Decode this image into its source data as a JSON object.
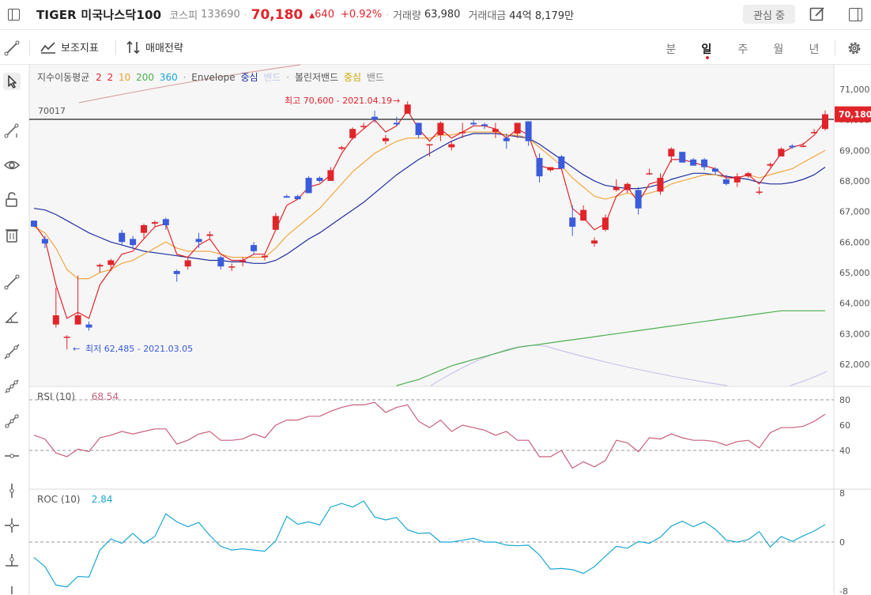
{
  "header": {
    "title": "TIGER 미국나스닥100",
    "market": "코스피",
    "code": "133690",
    "price": "70,180",
    "change": "640",
    "change_pct": "+0.92%",
    "volume_label": "거래량",
    "volume": "63,980",
    "amount_label": "거래대금",
    "amount": "44억 8,179만",
    "watch_label": "관심 중"
  },
  "toolbar": {
    "indicator_label": "보조지표",
    "strategy_label": "매매전략",
    "timeframes": [
      "분",
      "일",
      "주",
      "월",
      "년"
    ],
    "active_timeframe": "일"
  },
  "colors": {
    "up": "#e0242a",
    "down": "#3b5bdb",
    "ma2": "#e0242a",
    "ma10": "#f0a030",
    "ma200": "#4caf50",
    "ma360": "#7b88d4",
    "envelope": "#1e2f9e",
    "bollinger": "#c9b84a",
    "rsi": "#c8607a",
    "roc": "#1aa7d1"
  },
  "legend": {
    "ma_label": "지수이동평균",
    "ma_periods": [
      "2",
      "2",
      "10",
      "200",
      "360"
    ],
    "envelope_label": "Envelope",
    "envelope_center": "중심",
    "envelope_band": "밴드",
    "bollinger_label": "볼린저밴드",
    "bollinger_center": "중심",
    "bollinger_band": "밴드"
  },
  "chart_data": [
    {
      "type": "candlestick",
      "ylim": [
        61300,
        71800
      ],
      "y_ticks": [
        62000,
        63000,
        64000,
        65000,
        66000,
        67000,
        68000,
        69000,
        70000,
        71000
      ],
      "y_tick_labels": [
        "62,000",
        "63,000",
        "64,000",
        "65,000",
        "66,000",
        "67,000",
        "68,000",
        "69,000",
        "70,000",
        "71,000"
      ],
      "hline": 70017,
      "hline_label": "70017",
      "current_price_label": "70,180",
      "annotations": {
        "high": "최고 70,600 - 2021.04.19",
        "low": "최저 62,485 - 2021.03.05"
      },
      "ohlc": [
        [
          66700,
          66700,
          66500,
          66500
        ],
        [
          66100,
          66200,
          65800,
          65950
        ],
        [
          63300,
          64500,
          63200,
          63600
        ],
        [
          62900,
          62950,
          62485,
          62900
        ],
        [
          63300,
          64900,
          63300,
          63600
        ],
        [
          63300,
          63400,
          63100,
          63200
        ],
        [
          65200,
          65300,
          65000,
          65250
        ],
        [
          65250,
          65450,
          65050,
          65400
        ],
        [
          66300,
          66400,
          65900,
          66000
        ],
        [
          66100,
          66200,
          65800,
          65900
        ],
        [
          66300,
          66600,
          66100,
          66550
        ],
        [
          66600,
          66700,
          66500,
          66650
        ],
        [
          66750,
          66800,
          66400,
          66550
        ],
        [
          65050,
          65100,
          64700,
          64950
        ],
        [
          65200,
          65500,
          65100,
          65400
        ],
        [
          66100,
          66300,
          65800,
          66000
        ],
        [
          66200,
          66350,
          66100,
          66250
        ],
        [
          65500,
          65550,
          65100,
          65200
        ],
        [
          65200,
          65300,
          65050,
          65200
        ],
        [
          65350,
          65500,
          65200,
          65400
        ],
        [
          65900,
          66000,
          65600,
          65700
        ],
        [
          65500,
          65600,
          65400,
          65550
        ],
        [
          66400,
          66950,
          66400,
          66850
        ],
        [
          67500,
          67550,
          67450,
          67450
        ],
        [
          67500,
          67550,
          67400,
          67400
        ],
        [
          68100,
          68150,
          67600,
          67600
        ],
        [
          68100,
          68150,
          67950,
          68000
        ],
        [
          68000,
          68450,
          68000,
          68350
        ],
        [
          69050,
          69150,
          69000,
          69100
        ],
        [
          69400,
          69750,
          69350,
          69700
        ],
        [
          69800,
          69900,
          69700,
          69800
        ],
        [
          70100,
          70300,
          69900,
          70000
        ],
        [
          69300,
          69500,
          69200,
          69400
        ],
        [
          69900,
          70100,
          69800,
          69850
        ],
        [
          70200,
          70600,
          70200,
          70500
        ],
        [
          69900,
          69900,
          69400,
          69500
        ],
        [
          69200,
          69200,
          68800,
          69200
        ],
        [
          69500,
          69950,
          69300,
          69900
        ],
        [
          69100,
          69300,
          69000,
          69200
        ],
        [
          69600,
          69900,
          69400,
          69600
        ],
        [
          69900,
          70000,
          69800,
          69850
        ],
        [
          69850,
          69900,
          69700,
          69800
        ],
        [
          69600,
          69900,
          69400,
          69700
        ],
        [
          69400,
          69550,
          69050,
          69300
        ],
        [
          69550,
          69900,
          69400,
          69900
        ],
        [
          69950,
          69950,
          69150,
          69300
        ],
        [
          68750,
          68900,
          67950,
          68150
        ],
        [
          68350,
          68450,
          68300,
          68450
        ],
        [
          68800,
          68850,
          68550,
          68400
        ],
        [
          66800,
          67200,
          66200,
          66500
        ],
        [
          66700,
          67200,
          66700,
          67050
        ],
        [
          65950,
          66150,
          65850,
          66050
        ],
        [
          66400,
          66900,
          66350,
          66800
        ],
        [
          67700,
          68050,
          67650,
          67800
        ],
        [
          67700,
          67950,
          67600,
          67900
        ],
        [
          67700,
          67800,
          66900,
          67100
        ],
        [
          68250,
          68400,
          68200,
          68250
        ],
        [
          67650,
          68250,
          67550,
          68100
        ],
        [
          68800,
          69100,
          68600,
          69050
        ],
        [
          68950,
          68950,
          68600,
          68600
        ],
        [
          68700,
          68750,
          68550,
          68500
        ],
        [
          68700,
          68750,
          68350,
          68450
        ],
        [
          68400,
          68450,
          68200,
          68300
        ],
        [
          68050,
          68200,
          67850,
          67900
        ],
        [
          67950,
          68250,
          67800,
          68150
        ],
        [
          68150,
          68300,
          68100,
          68250
        ],
        [
          67650,
          67800,
          67550,
          67650
        ],
        [
          68500,
          68600,
          68450,
          68550
        ],
        [
          68800,
          69100,
          68800,
          69050
        ],
        [
          69150,
          69200,
          69050,
          69100
        ],
        [
          69150,
          69250,
          69100,
          69150
        ],
        [
          69600,
          69700,
          69550,
          69600
        ],
        [
          69700,
          70300,
          69650,
          70180
        ]
      ],
      "ma_fast": [
        66600,
        66100,
        64600,
        63500,
        63700,
        63500,
        64600,
        65100,
        65600,
        65700,
        66100,
        66500,
        66600,
        65600,
        65500,
        65900,
        66100,
        65600,
        65400,
        65400,
        65600,
        65600,
        66400,
        67200,
        67400,
        67800,
        67900,
        68200,
        68900,
        69400,
        69700,
        70000,
        69600,
        69800,
        70300,
        69700,
        69300,
        69700,
        69400,
        69600,
        69800,
        69800,
        69700,
        69400,
        69700,
        69500,
        68500,
        68400,
        68400,
        67100,
        66800,
        66400,
        66600,
        67500,
        67800,
        67300,
        67900,
        68000,
        68700,
        68700,
        68600,
        68500,
        68400,
        68100,
        68100,
        68200,
        67900,
        68400,
        68900,
        69100,
        69200,
        69500,
        69950
      ],
      "ma_10": [
        66500,
        66300,
        65800,
        65100,
        64800,
        64800,
        65000,
        65100,
        65300,
        65400,
        65600,
        65800,
        66000,
        65800,
        65700,
        65700,
        65700,
        65600,
        65500,
        65500,
        65500,
        65500,
        65800,
        66200,
        66500,
        66800,
        67100,
        67500,
        67900,
        68300,
        68600,
        68900,
        69100,
        69300,
        69400,
        69400,
        69400,
        69500,
        69500,
        69600,
        69600,
        69600,
        69600,
        69500,
        69500,
        69400,
        69100,
        68800,
        68500,
        68100,
        67800,
        67500,
        67400,
        67500,
        67600,
        67500,
        67600,
        67700,
        67900,
        68000,
        68100,
        68200,
        68200,
        68100,
        68100,
        68200,
        68100,
        68200,
        68300,
        68400,
        68600,
        68800,
        69000
      ],
      "envelope": [
        67100,
        67050,
        66900,
        66700,
        66500,
        66300,
        66150,
        66000,
        65900,
        65800,
        65700,
        65650,
        65600,
        65550,
        65500,
        65450,
        65400,
        65400,
        65350,
        65350,
        65300,
        65300,
        65400,
        65600,
        65850,
        66100,
        66300,
        66550,
        66800,
        67050,
        67300,
        67600,
        67900,
        68200,
        68450,
        68700,
        68900,
        69100,
        69300,
        69450,
        69550,
        69550,
        69550,
        69500,
        69450,
        69400,
        69200,
        68950,
        68700,
        68450,
        68200,
        68000,
        67850,
        67800,
        67750,
        67750,
        67800,
        67900,
        68050,
        68150,
        68250,
        68250,
        68200,
        68150,
        68100,
        68050,
        67950,
        67900,
        67900,
        67950,
        68050,
        68200,
        68450
      ],
      "ma_200": [
        null,
        null,
        null,
        null,
        null,
        null,
        null,
        null,
        null,
        null,
        null,
        null,
        null,
        null,
        null,
        null,
        null,
        null,
        null,
        null,
        null,
        null,
        null,
        null,
        null,
        null,
        null,
        null,
        null,
        null,
        null,
        null,
        null,
        61300,
        61400,
        61500,
        61650,
        61800,
        61950,
        62050,
        62150,
        62250,
        62350,
        62450,
        62550,
        62600,
        62650,
        62700,
        62750,
        62800,
        62850,
        62900,
        62950,
        63000,
        63050,
        63100,
        63150,
        63200,
        63250,
        63300,
        63350,
        63400,
        63450,
        63500,
        63550,
        63600,
        63650,
        63700,
        63750,
        63750,
        63750,
        63750,
        63750
      ]
    },
    {
      "type": "line",
      "name": "RSI (10)",
      "value_label": "68.54",
      "ylim": [
        10,
        90
      ],
      "y_ticks": [
        40,
        60,
        80
      ],
      "dashed": [
        40,
        80
      ],
      "values": [
        52,
        49,
        38,
        35,
        41,
        39,
        50,
        52,
        55,
        53,
        55,
        57,
        57,
        45,
        48,
        53,
        55,
        48,
        48,
        49,
        53,
        50,
        60,
        64,
        64,
        67,
        67,
        71,
        74,
        76,
        76,
        78,
        70,
        74,
        76,
        63,
        58,
        64,
        55,
        60,
        58,
        56,
        52,
        55,
        48,
        48,
        35,
        35,
        40,
        26,
        31,
        27,
        32,
        48,
        46,
        39,
        50,
        49,
        53,
        50,
        48,
        48,
        47,
        44,
        47,
        48,
        42,
        54,
        58,
        58,
        59,
        63,
        68.54
      ]
    },
    {
      "type": "line",
      "name": "ROC (10)",
      "value_label": "2.84",
      "ylim": [
        -8.5,
        8.5
      ],
      "y_ticks": [
        -8,
        0,
        8
      ],
      "y_tick_labels": [
        "-8",
        "0",
        "8"
      ],
      "dashed": [
        0
      ],
      "values": [
        -2.5,
        -4.0,
        -7.0,
        -7.3,
        -5.6,
        -5.7,
        -1.3,
        0.5,
        -0.2,
        1.4,
        -0.2,
        0.9,
        4.6,
        3.3,
        2.5,
        3.2,
        1.1,
        -0.7,
        -1.3,
        -1.1,
        -1.3,
        -1.5,
        0.2,
        4.2,
        2.9,
        3.3,
        2.8,
        5.7,
        6.3,
        5.7,
        6.7,
        4.1,
        3.6,
        4.0,
        2.0,
        1.4,
        1.5,
        0.0,
        0.0,
        0.3,
        0.6,
        0.0,
        0.0,
        -0.5,
        -0.6,
        -0.5,
        -2.1,
        -4.4,
        -4.3,
        -4.5,
        -5.1,
        -4.0,
        -2.3,
        -0.7,
        -1.0,
        0.1,
        -0.2,
        0.8,
        2.6,
        3.4,
        2.5,
        3.3,
        2.1,
        0.3,
        0.0,
        0.4,
        1.7,
        -0.8,
        0.9,
        0.1,
        1.0,
        1.8,
        2.84
      ]
    }
  ],
  "time_axis_labels": []
}
